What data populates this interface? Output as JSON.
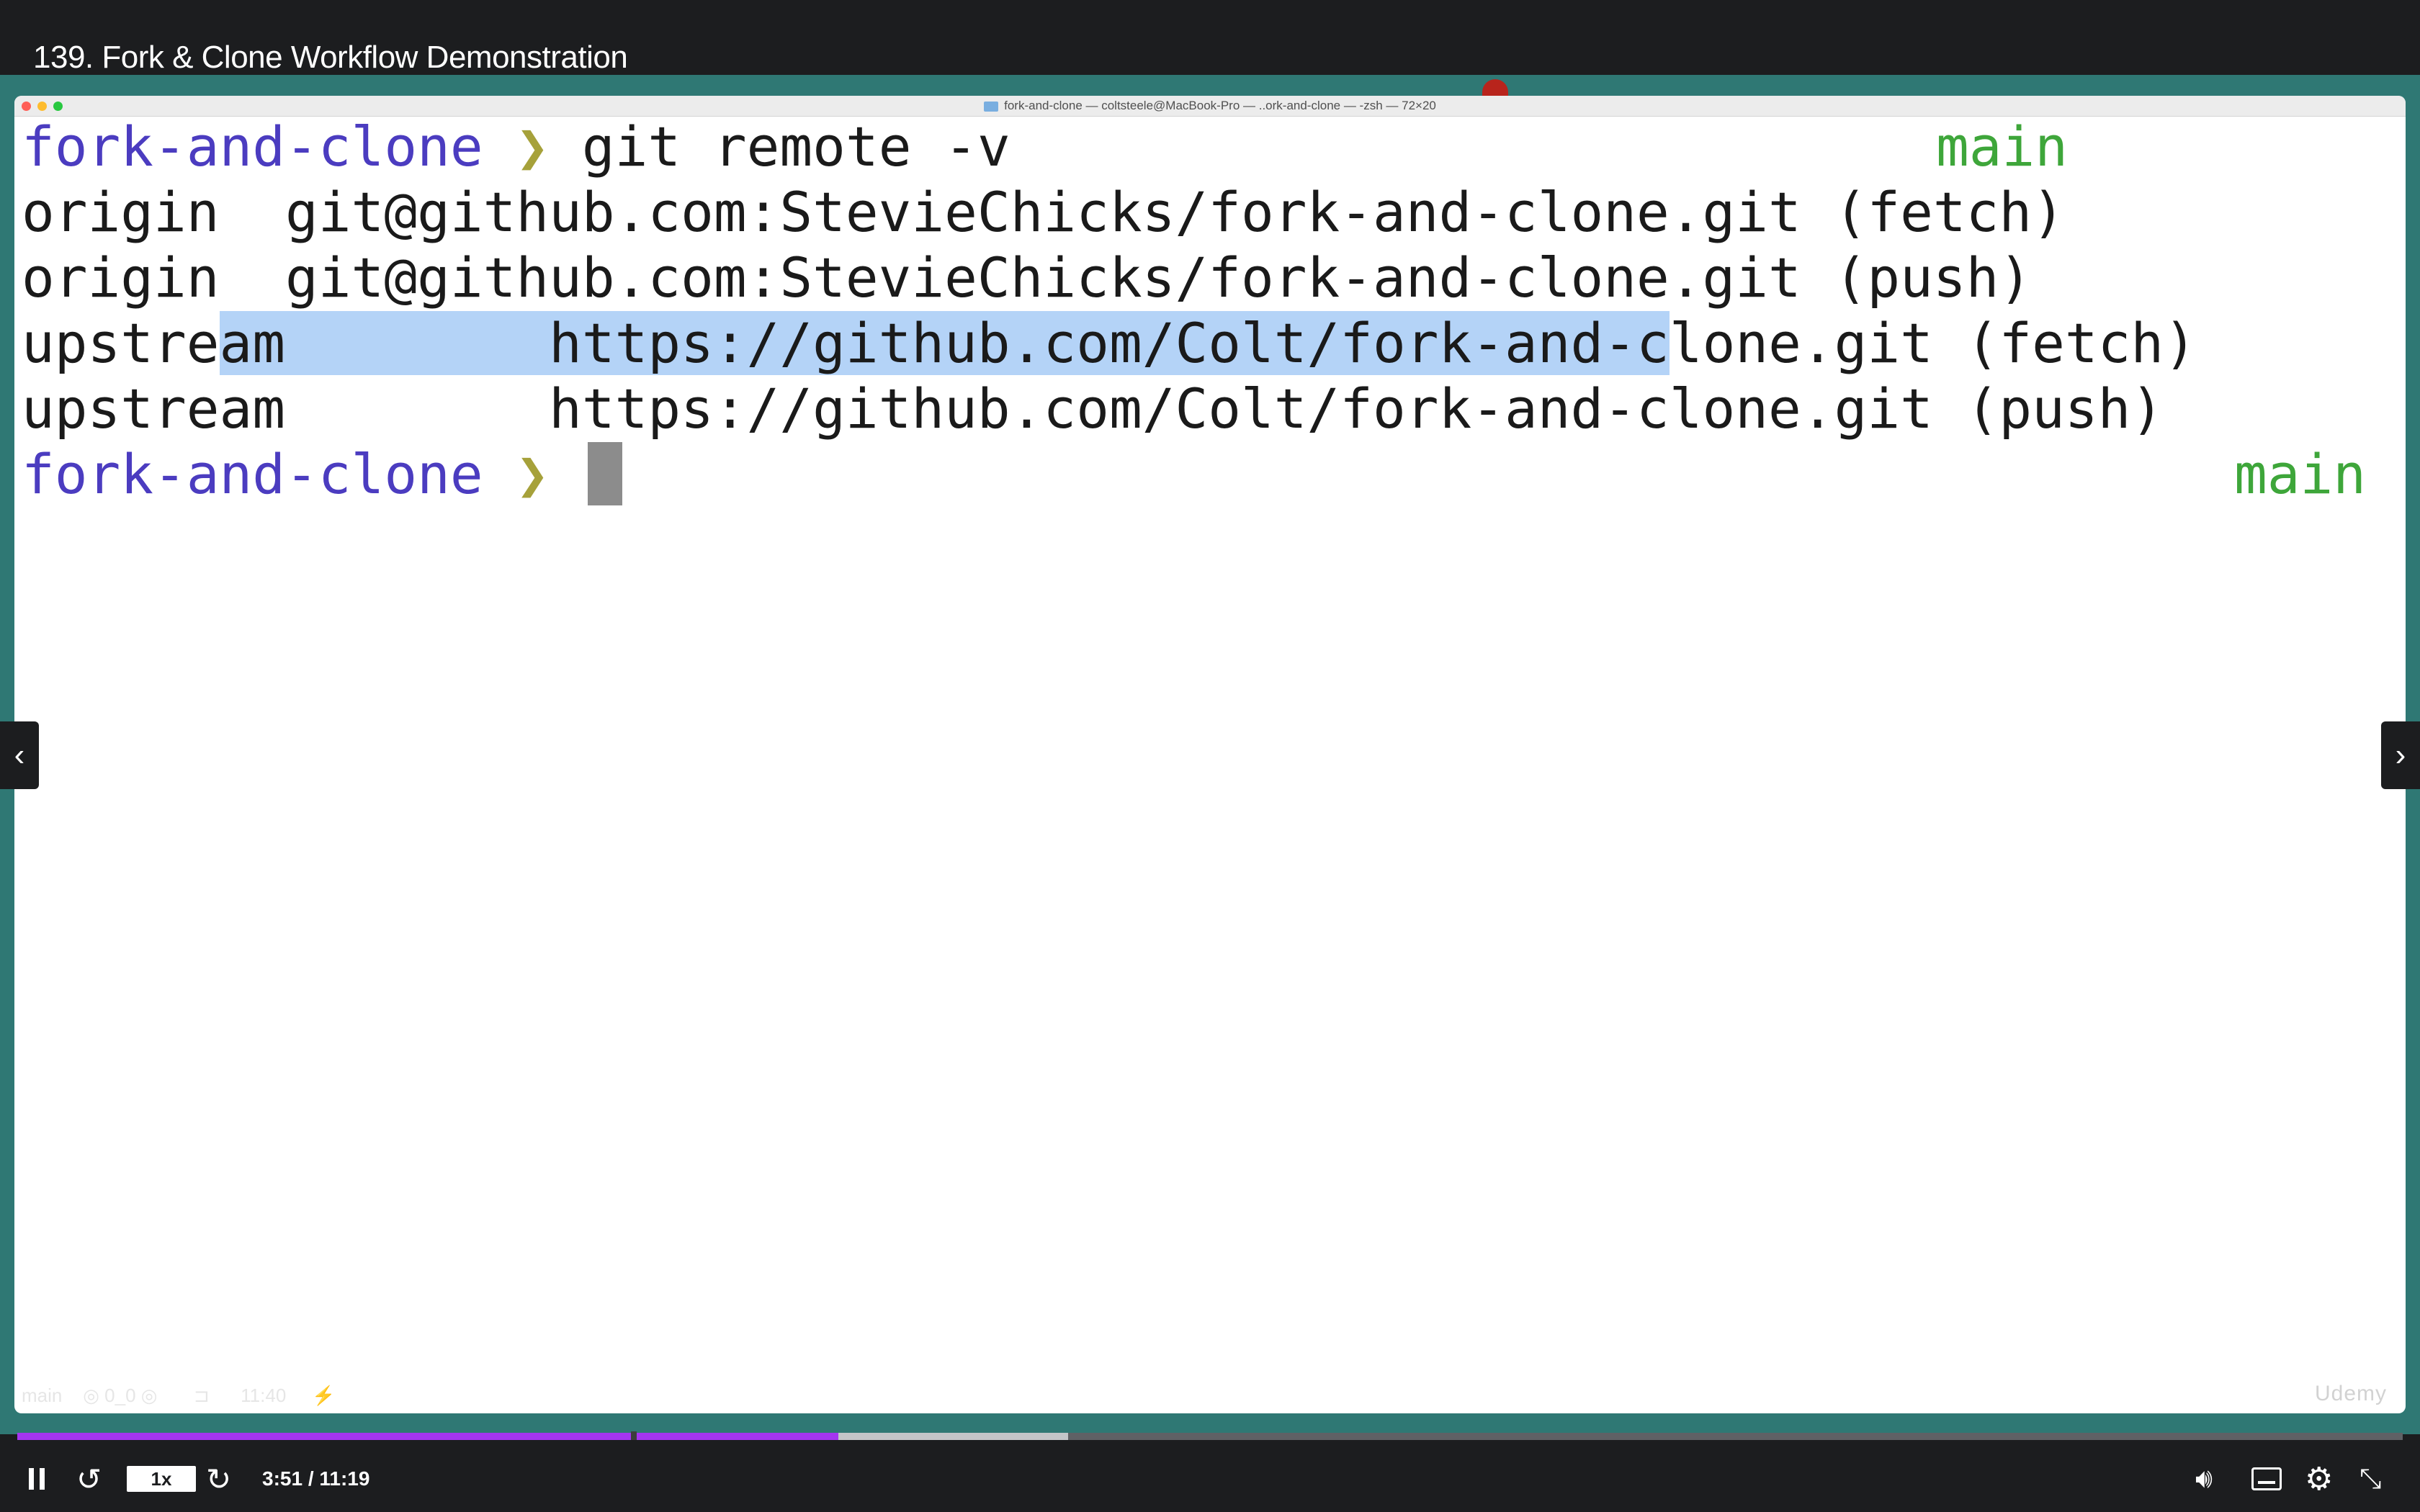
{
  "lecture": {
    "title": "139. Fork & Clone Workflow Demonstration"
  },
  "terminal": {
    "window_title": "fork-and-clone — coltsteele@MacBook-Pro — ..ork-and-clone — -zsh — 72×20",
    "prompt_dir": "fork-and-clone",
    "prompt_arrow": "❯",
    "command": "git remote -v",
    "branch": "main",
    "output": [
      "origin  git@github.com:StevieChicks/fork-and-clone.git (fetch)",
      "origin  git@github.com:StevieChicks/fork-and-clone.git (push)",
      "upstream        https://github.com/Colt/fork-and-clone.git (push)"
    ],
    "selected_line": {
      "pre": "upstre",
      "selected": "am        https://github.com/Colt/fork-and-c",
      "post": "lone.git (fetch)"
    },
    "faint_bar_text": "main    ◎ 0_0 ◎       ⊐      11:40     ⚡"
  },
  "watermark": "Udemy",
  "player": {
    "rate": "1x",
    "time": "3:51 / 11:19",
    "progress_fraction": 0.3443,
    "buffered_fraction": 0.4405,
    "icons": {
      "prev": "chevron-left-icon",
      "next": "chevron-right-icon",
      "rewind": "rewind-5-icon",
      "forward": "forward-5-icon",
      "volume": "volume-icon",
      "captions": "captions-icon",
      "settings": "gear-icon",
      "fullscreen": "exit-fullscreen-icon"
    },
    "colors": {
      "progress": "#a435f0",
      "background": "#1c1d1f"
    }
  }
}
